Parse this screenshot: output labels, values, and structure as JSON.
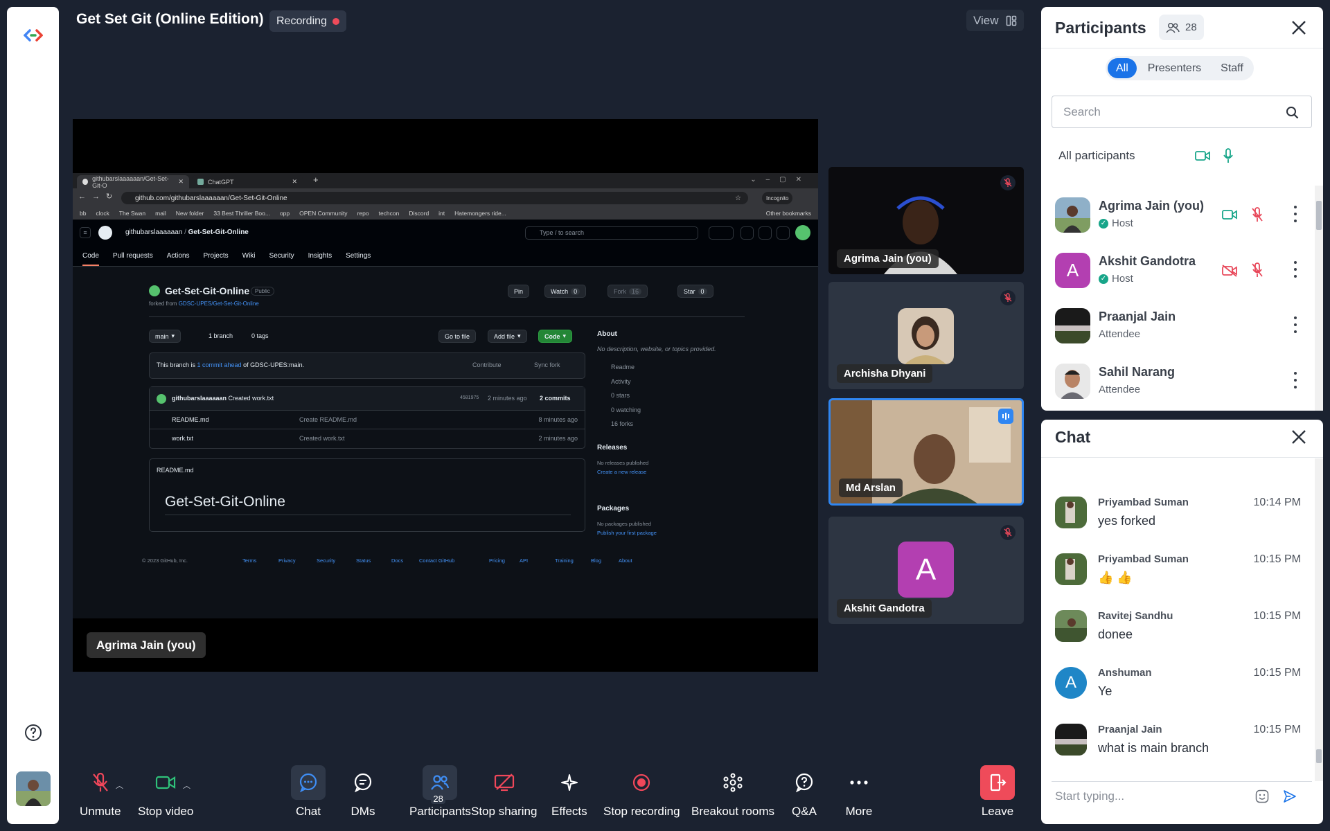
{
  "meeting": {
    "title": "Get Set Git (Online Edition)",
    "recording_label": "Recording",
    "view_label": "View",
    "recording_color": "#ef4b5a",
    "accent": "#1a73e8"
  },
  "stage": {
    "presenter_name": "Agrima Jain (you)",
    "browser": {
      "tabs": [
        "githubarslaaaaaan/Get-Set-Git-O",
        "ChatGPT"
      ],
      "url": "github.com/githubarslaaaaaan/Get-Set-Git-Online",
      "incognito_label": "Incognito",
      "bookmarks": [
        "bb",
        "clock",
        "The Swan",
        "mail",
        "New folder",
        "33 Best Thriller Boo...",
        "opp",
        "OPEN Community",
        "repo",
        "techcon",
        "Discord",
        "int",
        "Hatemongers ride...",
        "Other bookmarks"
      ],
      "github": {
        "breadcrumb_user": "githubarslaaaaaan",
        "breadcrumb_repo": "Get-Set-Git-Online",
        "search_placeholder": "Type / to search",
        "nav": [
          "Code",
          "Pull requests",
          "Actions",
          "Projects",
          "Wiki",
          "Security",
          "Insights",
          "Settings"
        ],
        "repo_name": "Get-Set-Git-Online",
        "visibility": "Public",
        "forked_from_prefix": "forked from ",
        "forked_from": "GDSC-UPES/Get-Set-Git-Online",
        "pin": "Pin",
        "watch": "Watch",
        "watch_count": "0",
        "fork": "Fork",
        "fork_count": "16",
        "star": "Star",
        "star_count": "0",
        "branch_select": "main",
        "branch_count": "1 branch",
        "tags_count": "0 tags",
        "go_to_file": "Go to file",
        "add_file": "Add file",
        "code_btn": "Code",
        "ahead_prefix": "This branch is ",
        "ahead_link": "1 commit ahead",
        "ahead_suffix": " of GDSC-UPES:main.",
        "contribute": "Contribute",
        "sync_fork": "Sync fork",
        "last_commit_user": "githubarslaaaaaan",
        "last_commit_msg": "Created work.txt",
        "last_commit_hash": "4581975",
        "last_commit_time": "2 minutes ago",
        "commits": "2 commits",
        "files": [
          {
            "name": "README.md",
            "msg": "Create README.md",
            "time": "8 minutes ago"
          },
          {
            "name": "work.txt",
            "msg": "Created work.txt",
            "time": "2 minutes ago"
          }
        ],
        "readme_file": "README.md",
        "readme_heading": "Get-Set-Git-Online",
        "about_title": "About",
        "about_desc": "No description, website, or topics provided.",
        "about_items": [
          "Readme",
          "Activity",
          "0 stars",
          "0 watching",
          "16 forks"
        ],
        "releases_title": "Releases",
        "releases_none": "No releases published",
        "releases_link": "Create a new release",
        "packages_title": "Packages",
        "packages_none": "No packages published",
        "packages_link": "Publish your first package",
        "footer_copy": "© 2023 GitHub, Inc.",
        "footer_links": [
          "Terms",
          "Privacy",
          "Security",
          "Status",
          "Docs",
          "Contact GitHub",
          "Pricing",
          "API",
          "Training",
          "Blog",
          "About"
        ]
      }
    }
  },
  "tiles": [
    {
      "name": "Agrima Jain (you)",
      "muted": true
    },
    {
      "name": "Archisha Dhyani",
      "muted": true
    },
    {
      "name": "Md Arslan",
      "muted": false,
      "speaking": true
    },
    {
      "name": "Akshit Gandotra",
      "muted": true,
      "initial": "A"
    }
  ],
  "participants": {
    "title": "Participants",
    "count": "28",
    "filters": [
      "All",
      "Presenters",
      "Staff"
    ],
    "active_filter": "All",
    "search_placeholder": "Search",
    "all_label": "All participants",
    "list": [
      {
        "name": "Agrima Jain (you)",
        "role": "Host"
      },
      {
        "name": "Akshit Gandotra",
        "role": "Host",
        "initial": "A"
      },
      {
        "name": "Praanjal Jain",
        "role": "Attendee"
      },
      {
        "name": "Sahil Narang",
        "role": "Attendee"
      }
    ]
  },
  "chat": {
    "title": "Chat",
    "input_placeholder": "Start typing...",
    "messages": [
      {
        "sender": "Priyambad Suman",
        "time": "10:14 PM",
        "text": "yes forked"
      },
      {
        "sender": "Priyambad Suman",
        "time": "10:15 PM",
        "text": "👍 👍"
      },
      {
        "sender": "Ravitej Sandhu",
        "time": "10:15 PM",
        "text": "donee"
      },
      {
        "sender": "Anshuman",
        "time": "10:15 PM",
        "text": "Ye",
        "initial": "A"
      },
      {
        "sender": "Praanjal Jain",
        "time": "10:15 PM",
        "text": "what is main branch"
      }
    ]
  },
  "toolbar": {
    "unmute": "Unmute",
    "stop_video": "Stop video",
    "chat": "Chat",
    "dms": "DMs",
    "participants": "Participants",
    "participants_badge": "28",
    "stop_sharing": "Stop sharing",
    "effects": "Effects",
    "stop_recording": "Stop recording",
    "breakout": "Breakout rooms",
    "qa": "Q&A",
    "more": "More",
    "leave": "Leave"
  }
}
